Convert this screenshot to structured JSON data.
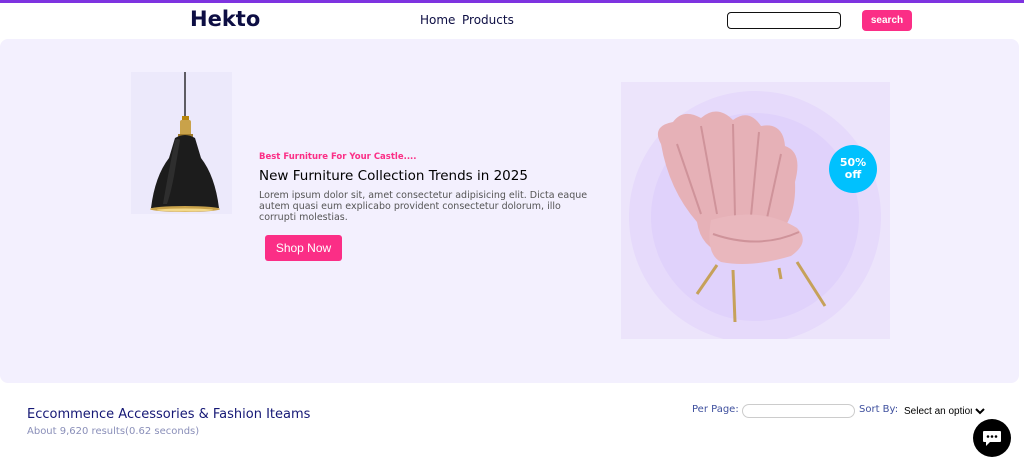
{
  "header": {
    "logo": "Hekto",
    "nav": [
      {
        "label": "Home"
      },
      {
        "label": "Products"
      }
    ],
    "search": {
      "value": "",
      "placeholder": "",
      "button_label": "search"
    }
  },
  "hero": {
    "tagline": "Best Furniture For Your Castle....",
    "headline": "New Furniture Collection Trends in 2025",
    "description": "Lorem ipsum dolor sit, amet consectetur adipisicing elit. Dicta eaque autem quasi eum explicabo provident consectetur dolorum, illo corrupti molestias.",
    "cta_label": "Shop Now",
    "discount_line1": "50%",
    "discount_line2": "off"
  },
  "results": {
    "title": "Eccommence Accessories & Fashion Iteams",
    "subtitle": "About 9,620 results(0.62 seconds)",
    "per_page_label": "Per Page:",
    "per_page_value": "",
    "sort_label": "Sort By:",
    "sort_selected": "Select an option"
  },
  "colors": {
    "accent": "#fb2e86",
    "brand_purple": "#7e33e0",
    "navy": "#0d0e43",
    "hero_bg": "#f3f0fe",
    "badge_blue": "#00c1fe"
  },
  "icons": {
    "chat": "chat-bubble-icon"
  }
}
